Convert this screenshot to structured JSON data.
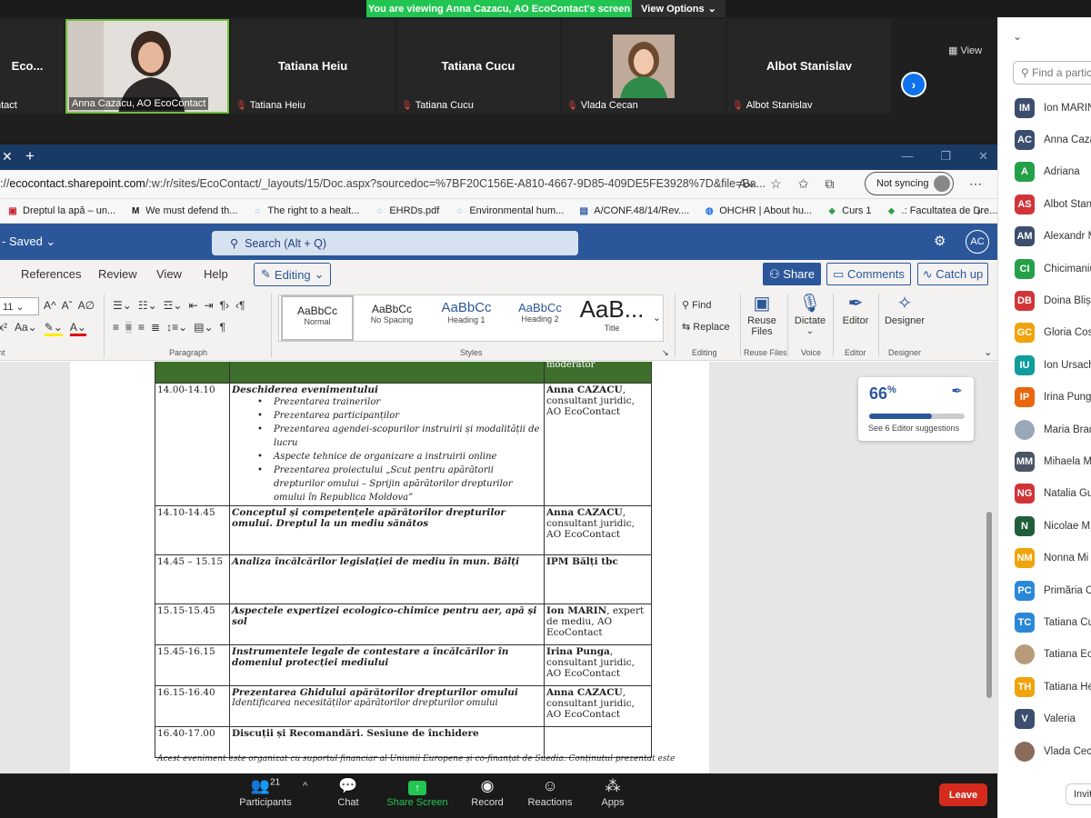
{
  "banner": {
    "viewing": "You are viewing Anna Cazacu, AO EcoContact's screen",
    "view_options": "View Options"
  },
  "video": {
    "view_label": "View",
    "tiles": [
      {
        "name": "Eco...",
        "label": "ntact"
      },
      {
        "name": "",
        "label": "Anna Cazacu, AO EcoContact"
      },
      {
        "name": "Tatiana Heiu",
        "label": "Tatiana Heiu"
      },
      {
        "name": "Tatiana Cucu",
        "label": "Tatiana Cucu"
      },
      {
        "name": "",
        "label": "Vlada Cecan"
      },
      {
        "name": "Albot Stanislav",
        "label": "Albot Stanislav"
      }
    ]
  },
  "participants_panel": {
    "search_placeholder": "Find a partic",
    "invite_label": "Invite",
    "items": [
      {
        "initials": "IM",
        "name": "Ion MARIN",
        "color": "#3c4e6e"
      },
      {
        "initials": "AC",
        "name": "Anna Cazacu",
        "color": "#3c4e6e"
      },
      {
        "initials": "A",
        "name": "Adriana",
        "color": "#24a148"
      },
      {
        "initials": "AS",
        "name": "Albot Stanislav",
        "color": "#d13438"
      },
      {
        "initials": "AM",
        "name": "Alexandr M",
        "color": "#3c4e6e"
      },
      {
        "initials": "CI",
        "name": "Chicimaniuc",
        "color": "#24a148"
      },
      {
        "initials": "DB",
        "name": "Doina Blișc",
        "color": "#d13438"
      },
      {
        "initials": "GC",
        "name": "Gloria Cos",
        "color": "#f0a30a"
      },
      {
        "initials": "IU",
        "name": "Ion Ursache",
        "color": "#0f9d9d"
      },
      {
        "initials": "IP",
        "name": "Irina Punga",
        "color": "#e8670f"
      },
      {
        "initials": "",
        "name": "Maria Brad",
        "color": "#9aa7b8"
      },
      {
        "initials": "MM",
        "name": "Mihaela M",
        "color": "#4b5563"
      },
      {
        "initials": "NG",
        "name": "Natalia Gu",
        "color": "#d13438"
      },
      {
        "initials": "N",
        "name": "Nicolae M",
        "color": "#1f5f3a"
      },
      {
        "initials": "NM",
        "name": "Nonna Mi",
        "color": "#f0a30a"
      },
      {
        "initials": "PC",
        "name": "Primăria C",
        "color": "#2b88d8"
      },
      {
        "initials": "TC",
        "name": "Tatiana Cucu",
        "color": "#2b88d8"
      },
      {
        "initials": "",
        "name": "Tatiana Ec",
        "color": "#b89a7a"
      },
      {
        "initials": "TH",
        "name": "Tatiana Heiu",
        "color": "#f0a30a"
      },
      {
        "initials": "V",
        "name": "Valeria",
        "color": "#3c4e6e"
      },
      {
        "initials": "",
        "name": "Vlada Cecan",
        "color": "#8a6a5a"
      }
    ]
  },
  "browser": {
    "url_prefix": "://",
    "url_host": "ecocontact.sharepoint.com",
    "url_path": "/:w:/r/sites/EcoContact/_layouts/15/Doc.aspx?sourcedoc=%7BF20C156E-A810-4667-9D85-409DE5FE3928%7D&file=Ba...",
    "sync_label": "Not syncing",
    "bookmarks": [
      {
        "icon": "flag",
        "label": "Dreptul la apă – un..."
      },
      {
        "icon": "M",
        "label": "We must defend th..."
      },
      {
        "icon": "globe",
        "label": "The right to a healt..."
      },
      {
        "icon": "globe",
        "label": "EHRDs.pdf"
      },
      {
        "icon": "globe",
        "label": "Environmental hum..."
      },
      {
        "icon": "doc",
        "label": "A/CONF.48/14/Rev...."
      },
      {
        "icon": "ohchr",
        "label": "OHCHR | About hu..."
      },
      {
        "icon": "green",
        "label": "Curs 1"
      },
      {
        "icon": "green",
        "label": ".: Facultatea de Dre..."
      }
    ]
  },
  "word": {
    "saved": "- Saved",
    "search_placeholder": "Search (Alt + Q)",
    "account": "AC",
    "tabs": [
      "References",
      "Review",
      "View",
      "Help"
    ],
    "editing_label": "Editing",
    "share_label": "Share",
    "comments_label": "Comments",
    "catchup_label": "Catch up",
    "font_size": "11",
    "groups": {
      "font": "nt",
      "paragraph": "Paragraph",
      "styles": "Styles",
      "editing": "Editing",
      "reuse": "Reuse Files",
      "voice": "Voice",
      "editor": "Editor",
      "designer": "Designer"
    },
    "styles": [
      {
        "sample": "AaBbCc",
        "name": "Normal"
      },
      {
        "sample": "AaBbCc",
        "name": "No Spacing"
      },
      {
        "sample": "AaBbCc",
        "name": "Heading 1"
      },
      {
        "sample": "AaBbCc",
        "name": "Heading 2"
      },
      {
        "sample": "AaB...",
        "name": "Title"
      }
    ],
    "find_label": "Find",
    "replace_label": "Replace",
    "reuse_label": "Reuse Files",
    "dictate_label": "Dictate",
    "editor_label": "Editor",
    "designer_label": "Designer",
    "editor_card": {
      "score": "66",
      "unit": "%",
      "progress": 0.66,
      "suggestions": "See 6 Editor suggestions"
    }
  },
  "document": {
    "header_moderator": "moderator",
    "rows": [
      {
        "time": "14.00-14.10",
        "title": "Deschiderea evenimentului",
        "bullets": [
          "Prezentarea trainerilor",
          "Prezentarea participanților",
          "Prezentarea agendei-scopurilor instruirii și modalității de lucru",
          "Aspecte tehnice de organizare a instruirii online",
          "Prezentarea proiectului „Scut pentru apărătorii drepturilor omului – Sprijin apărătorilor drepturilor omului în Republica Moldova”"
        ],
        "speaker_bold": "Anna CAZACU",
        "speaker_rest": ", consultant juridic, AO EcoContact"
      },
      {
        "time": "14.10-14.45",
        "title": "Conceptul și competențele apărătorilor drepturilor omului. Dreptul la un mediu sănătos",
        "speaker_bold": "Anna CAZACU",
        "speaker_rest": ", consultant juridic, AO EcoContact"
      },
      {
        "time": "14.45 – 15.15",
        "title": "Analiza încălcărilor legislației de mediu în mun. Bălți",
        "speaker_bold": "IPM Bălți tbc",
        "speaker_rest": ""
      },
      {
        "time": "15.15-15.45",
        "title": "Aspectele expertizei ecologico-chimice pentru aer, apă și sol",
        "speaker_bold": "Ion MARIN",
        "speaker_rest": ", expert de mediu, AO EcoContact"
      },
      {
        "time": "15.45-16.15",
        "title": "Instrumentele legale de contestare a încălcărilor în domeniul protecției mediului",
        "speaker_bold": "Irina Punga",
        "speaker_rest": ", consultant juridic, AO EcoContact"
      },
      {
        "time": "16.15-16.40",
        "title": "Prezentarea Ghidului apărătorilor drepturilor omului",
        "subtitle": "Identificarea necesităților apărătorilor drepturilor omului",
        "speaker_bold": "Anna CAZACU",
        "speaker_rest": ", consultant juridic, AO EcoContact"
      },
      {
        "time": "16.40-17.00",
        "title": "Discuții și Recomandări. Sesiune de închidere",
        "speaker_bold": "",
        "speaker_rest": ""
      }
    ],
    "footer": "Acest eveniment este organizat cu suportul financiar al Uniunii Europene și co-finanțat de Suedia. Conținutul prezentat este"
  },
  "zoom_toolbar": {
    "participants_count": "21",
    "participants": "Participants",
    "chat": "Chat",
    "share_screen": "Share Screen",
    "record": "Record",
    "reactions": "Reactions",
    "apps": "Apps",
    "leave": "Leave"
  }
}
